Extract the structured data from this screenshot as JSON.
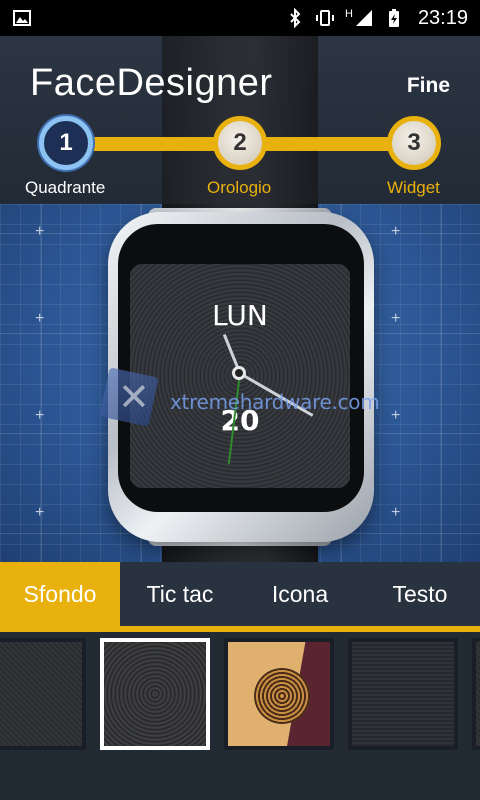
{
  "status_bar": {
    "time": "23:19",
    "network_label": "H",
    "left_icon": "image-icon",
    "right_icons": [
      "bluetooth-icon",
      "vibrate-icon",
      "signal-icon",
      "battery-charging-icon"
    ]
  },
  "header": {
    "title": "FaceDesigner",
    "done_label": "Fine"
  },
  "stepper": {
    "steps": [
      {
        "number": "1",
        "label": "Quadrante",
        "active": true
      },
      {
        "number": "2",
        "label": "Orologio",
        "active": false
      },
      {
        "number": "3",
        "label": "Widget",
        "active": false
      }
    ]
  },
  "watch_preview": {
    "day": "LUN",
    "date": "20",
    "watermark": "xtremehardware.com"
  },
  "tabs": [
    {
      "label": "Sfondo",
      "active": true
    },
    {
      "label": "Tic tac",
      "active": false
    },
    {
      "label": "Icona",
      "active": false
    },
    {
      "label": "Testo",
      "active": false
    }
  ],
  "thumbnails": [
    {
      "name": "dark-texture",
      "selected": false
    },
    {
      "name": "radial-brushed",
      "selected": true
    },
    {
      "name": "tan-maroon-rings",
      "selected": false
    },
    {
      "name": "dark-mesh",
      "selected": false
    },
    {
      "name": "dark-pattern",
      "selected": false
    }
  ],
  "colors": {
    "accent": "#e9b10d",
    "active_step": "#8cc3f2",
    "background": "#2a3340",
    "preview_blue": "#3e6fb4"
  }
}
